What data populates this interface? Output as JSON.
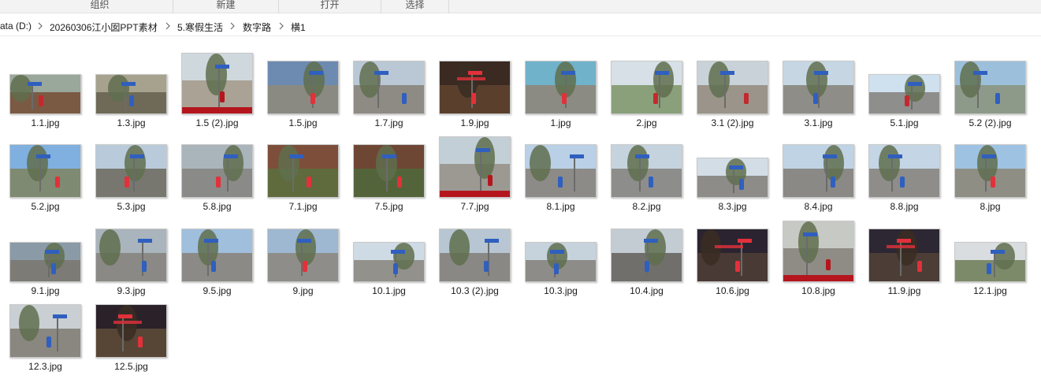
{
  "ribbon": {
    "groups": [
      "组织",
      "新建",
      "打开",
      "选择"
    ]
  },
  "address": {
    "crumbs": [
      "ata (D:)",
      "20260306江小囡PPT素材",
      "5.寒假生活",
      "数字路",
      "横1"
    ]
  },
  "files": [
    {
      "name": "1.1.jpg",
      "sky": "#9aa79b",
      "ground": "#7b5a44",
      "accent": "#c4292f",
      "landscape": "wide"
    },
    {
      "name": "1.3.jpg",
      "sky": "#a6a28e",
      "ground": "#6f6a58",
      "accent": "#2f5fbf",
      "landscape": "wide"
    },
    {
      "name": "1.5 (2).jpg",
      "sky": "#cfd8dd",
      "ground": "#a9a295",
      "accent": "#b5161e",
      "landscape": "tall",
      "band": true
    },
    {
      "name": "1.5.jpg",
      "sky": "#6d8bb0",
      "ground": "#8a8a82",
      "accent": "#e2313b",
      "landscape": "mid"
    },
    {
      "name": "1.7.jpg",
      "sky": "#b9c8d4",
      "ground": "#8d8b84",
      "accent": "#2f5fbf",
      "landscape": "mid"
    },
    {
      "name": "1.9.jpg",
      "sky": "#3a2a22",
      "ground": "#5a3f2c",
      "accent": "#e2313b",
      "landscape": "mid",
      "night": true
    },
    {
      "name": "1.jpg",
      "sky": "#6fb2c9",
      "ground": "#8c8b83",
      "accent": "#e2313b",
      "landscape": "mid"
    },
    {
      "name": "2.jpg",
      "sky": "#d7e0e6",
      "ground": "#8aa07a",
      "accent": "#c4292f",
      "landscape": "mid"
    },
    {
      "name": "3.1 (2).jpg",
      "sky": "#c9d2d8",
      "ground": "#9a948a",
      "accent": "#c4292f",
      "landscape": "mid"
    },
    {
      "name": "3.1.jpg",
      "sky": "#c6d6e2",
      "ground": "#8f8d88",
      "accent": "#2f5fbf",
      "landscape": "mid"
    },
    {
      "name": "5.1.jpg",
      "sky": "#cfe0ef",
      "ground": "#8e8e8c",
      "accent": "#c4292f",
      "landscape": "wide2"
    },
    {
      "name": "5.2 (2).jpg",
      "sky": "#9cc0dc",
      "ground": "#8d9a8a",
      "accent": "#2f5fbf",
      "landscape": "mid"
    },
    {
      "name": "5.2.jpg",
      "sky": "#7fb0e0",
      "ground": "#7f8a72",
      "accent": "#e2313b",
      "landscape": "mid"
    },
    {
      "name": "5.3.jpg",
      "sky": "#b9cadb",
      "ground": "#777770",
      "accent": "#e2313b",
      "landscape": "mid"
    },
    {
      "name": "5.8.jpg",
      "sky": "#aab4bb",
      "ground": "#8a8a88",
      "accent": "#e2313b",
      "landscape": "mid"
    },
    {
      "name": "7.1.jpg",
      "sky": "#7d4e3a",
      "ground": "#5f6a3d",
      "accent": "#e2313b",
      "landscape": "mid"
    },
    {
      "name": "7.5.jpg",
      "sky": "#6e4634",
      "ground": "#53643a",
      "accent": "#e2313b",
      "landscape": "mid"
    },
    {
      "name": "7.7.jpg",
      "sky": "#c3cfd6",
      "ground": "#9c9892",
      "accent": "#b5161e",
      "landscape": "tall",
      "band": true
    },
    {
      "name": "8.1.jpg",
      "sky": "#b9d0e6",
      "ground": "#8c8b88",
      "accent": "#2f5fbf",
      "landscape": "mid"
    },
    {
      "name": "8.2.jpg",
      "sky": "#c5d3de",
      "ground": "#8d8d8b",
      "accent": "#2f5fbf",
      "landscape": "mid"
    },
    {
      "name": "8.3.jpg",
      "sky": "#d3dde5",
      "ground": "#8d8c89",
      "accent": "#2f5fbf",
      "landscape": "wide2"
    },
    {
      "name": "8.4.jpg",
      "sky": "#bfd3e4",
      "ground": "#8a8986",
      "accent": "#2f5fbf",
      "landscape": "mid"
    },
    {
      "name": "8.8.jpg",
      "sky": "#c4d6e5",
      "ground": "#8e8d8a",
      "accent": "#2f5fbf",
      "landscape": "mid"
    },
    {
      "name": "8.jpg",
      "sky": "#9ec3e2",
      "ground": "#8f8e85",
      "accent": "#e2313b",
      "landscape": "mid"
    },
    {
      "name": "9.1.jpg",
      "sky": "#8a9aa6",
      "ground": "#7c7b76",
      "accent": "#2f5fbf",
      "landscape": "wide"
    },
    {
      "name": "9.3.jpg",
      "sky": "#a9b4bc",
      "ground": "#8a8985",
      "accent": "#2f5fbf",
      "landscape": "mid"
    },
    {
      "name": "9.5.jpg",
      "sky": "#9fbfdc",
      "ground": "#8b8a86",
      "accent": "#2f5fbf",
      "landscape": "mid"
    },
    {
      "name": "9.jpg",
      "sky": "#9fb8d2",
      "ground": "#8e8d89",
      "accent": "#e2313b",
      "landscape": "mid"
    },
    {
      "name": "10.1.jpg",
      "sky": "#cfdbe4",
      "ground": "#93918c",
      "accent": "#2f5fbf",
      "landscape": "wide"
    },
    {
      "name": "10.3 (2).jpg",
      "sky": "#b7c6d2",
      "ground": "#898884",
      "accent": "#2f5fbf",
      "landscape": "mid"
    },
    {
      "name": "10.3.jpg",
      "sky": "#c6d2dc",
      "ground": "#8e8c88",
      "accent": "#2f5fbf",
      "landscape": "wide"
    },
    {
      "name": "10.4.jpg",
      "sky": "#c3ccd3",
      "ground": "#706f6c",
      "accent": "#2f5fbf",
      "landscape": "mid"
    },
    {
      "name": "10.6.jpg",
      "sky": "#2b2430",
      "ground": "#4a3a35",
      "accent": "#e2313b",
      "landscape": "mid",
      "night": true
    },
    {
      "name": "10.8.jpg",
      "sky": "#c7c9c4",
      "ground": "#8f8c86",
      "accent": "#b5161e",
      "landscape": "tall",
      "band": true
    },
    {
      "name": "11.9.jpg",
      "sky": "#2d2733",
      "ground": "#4c3d37",
      "accent": "#e2313b",
      "landscape": "mid",
      "night": true
    },
    {
      "name": "12.1.jpg",
      "sky": "#d9dde0",
      "ground": "#7d8a6a",
      "accent": "#2f5fbf",
      "landscape": "wide"
    },
    {
      "name": "12.3.jpg",
      "sky": "#c9cfd3",
      "ground": "#8a8780",
      "accent": "#2f5fbf",
      "landscape": "mid"
    },
    {
      "name": "12.5.jpg",
      "sky": "#2a2228",
      "ground": "#574636",
      "accent": "#e2313b",
      "landscape": "mid",
      "night": true
    }
  ]
}
